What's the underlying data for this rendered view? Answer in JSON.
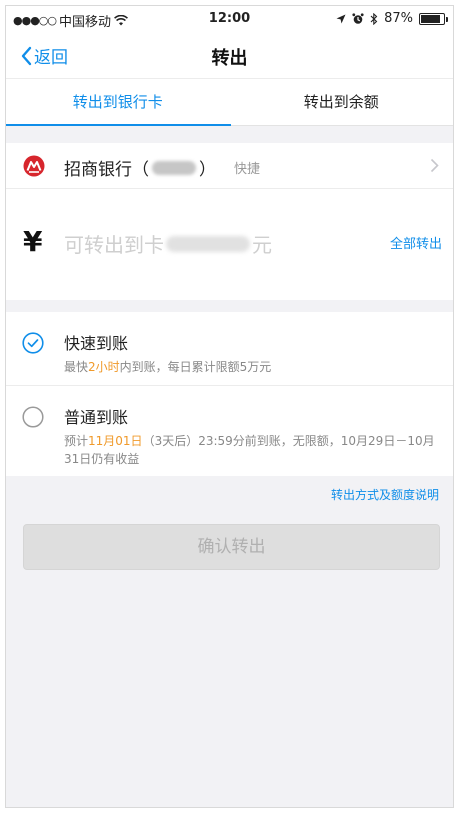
{
  "status_bar": {
    "signal": "●●●○○",
    "carrier": "中国移动",
    "time": "12:00",
    "battery": "87%",
    "battery_level": 0.87
  },
  "navbar": {
    "back_label": "返回",
    "title": "转出"
  },
  "tabs": [
    {
      "label": "转出到银行卡",
      "active": true
    },
    {
      "label": "转出到余额",
      "active": false
    }
  ],
  "bank": {
    "name": "招商银行（",
    "name_end": "）",
    "tag": "快捷"
  },
  "amount": {
    "currency_symbol": "¥",
    "placeholder_prefix": "可转出到卡",
    "placeholder_suffix": "元",
    "all_out_label": "全部转出"
  },
  "options": {
    "fast": {
      "title": "快速到账",
      "desc_prefix": "最快",
      "desc_highlight": "2小时",
      "desc_suffix": "内到账，每日累计限额5万元",
      "selected": true
    },
    "normal": {
      "title": "普通到账",
      "desc_prefix": "预计",
      "desc_highlight": "11月01日",
      "desc_suffix": "（3天后）23:59分前到账，无限额，10月29日－10月31日仍有收益",
      "selected": false
    }
  },
  "explain_link": "转出方式及额度说明",
  "confirm_label": "确认转出",
  "colors": {
    "accent": "#108ee9",
    "highlight": "#f09a2b",
    "bank_red": "#d7262d"
  }
}
